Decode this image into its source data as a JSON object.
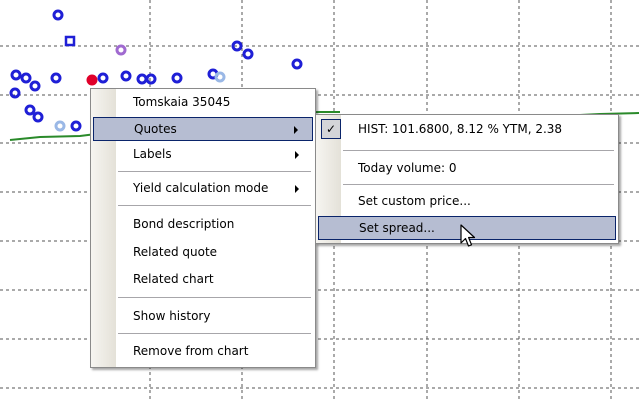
{
  "context_menu": {
    "items": [
      {
        "label": "Tomskaia 35045",
        "submenu": false
      },
      {
        "label": "Quotes",
        "submenu": true,
        "selected": true
      },
      {
        "label": "Labels",
        "submenu": true
      },
      {
        "label": "Yield calculation mode",
        "submenu": true
      },
      {
        "label": "Bond description"
      },
      {
        "label": "Related quote"
      },
      {
        "label": "Related chart"
      },
      {
        "label": "Show history"
      },
      {
        "label": "Remove from chart"
      }
    ]
  },
  "quotes_submenu": {
    "items": [
      {
        "label": "HIST: 101.6800, 8.12 % YTM, 2.38",
        "checked": true
      },
      {
        "label": "Today volume: 0"
      },
      {
        "label": "Set custom price..."
      },
      {
        "label": "Set spread...",
        "selected": true
      }
    ]
  },
  "colors": {
    "marker_blue": "#1f1fd6",
    "marker_red": "#e0002a",
    "marker_purple": "#a06ad0",
    "marker_lightblue": "#9ab8e6",
    "curve_green": "#2a8a2a",
    "highlight": "#b6bdd2",
    "grid_dash": "#555555"
  },
  "icons": [
    "checkmark-icon",
    "submenu-arrow-icon",
    "mouse-cursor-icon"
  ]
}
